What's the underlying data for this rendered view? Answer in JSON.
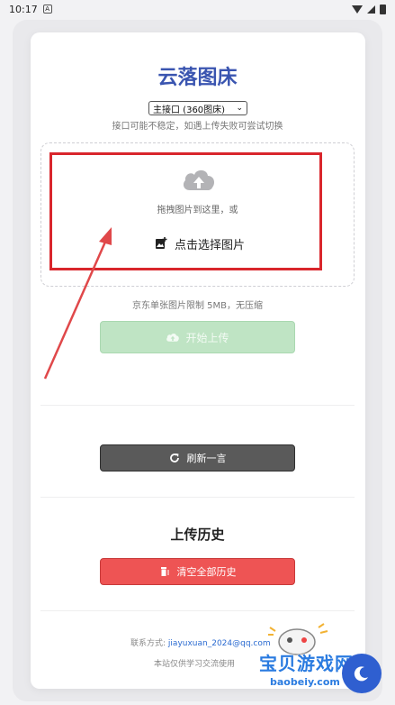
{
  "status_bar": {
    "time": "10:17"
  },
  "header": {
    "title": "云落图床"
  },
  "interface_select": {
    "value": "主接口 (360图床)"
  },
  "hint": "接口可能不稳定，如遇上传失败可尝试切换",
  "dropzone": {
    "drag_text": "拖拽图片到这里，或",
    "pick_label": "点击选择图片"
  },
  "limit_text": "京东单张图片限制 5MB，无压缩",
  "buttons": {
    "upload": "开始上传",
    "refresh": "刷新一言",
    "clear_history": "清空全部历史"
  },
  "history": {
    "title": "上传历史"
  },
  "footer": {
    "contact_label": "联系方式:",
    "contact_email": "jiayuxuan_2024@qq.com",
    "note": "本站仅供学习交流使用"
  },
  "watermark": {
    "text": "宝贝游戏网",
    "sub": "baobeiy.com"
  },
  "colors": {
    "title": "#3a55b0",
    "annotation": "#d9262c",
    "upload_button": "#bfe4c4",
    "refresh_button": "#5a5a5a",
    "clear_button": "#ee5454"
  }
}
